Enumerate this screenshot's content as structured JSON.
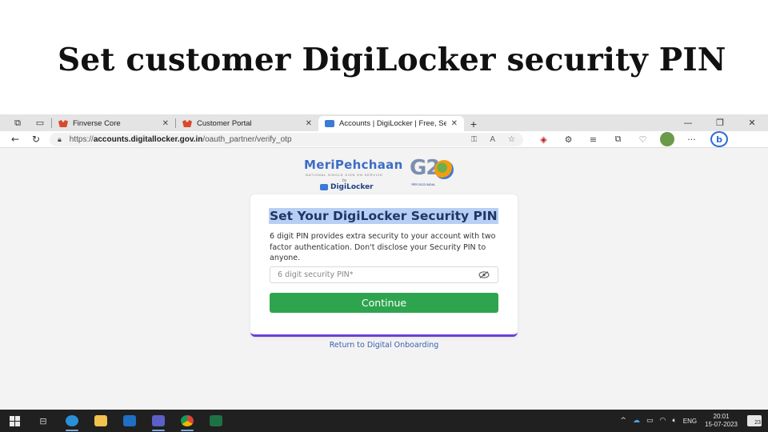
{
  "slide": {
    "title": "Set customer DigiLocker security PIN"
  },
  "browser": {
    "tabs": [
      {
        "label": "Finverse Core",
        "close": "✕"
      },
      {
        "label": "Customer Portal",
        "close": "✕"
      },
      {
        "label": "Accounts | DigiLocker | Free, Sec",
        "close": "✕"
      }
    ],
    "new_tab": "+",
    "window_controls": {
      "minimize": "—",
      "restore": "❐",
      "close": "✕"
    },
    "address": {
      "scheme": "https://",
      "host": "accounts.digitallocker.gov.in",
      "path": "/oauth_partner/verify_otp"
    }
  },
  "page": {
    "logo": {
      "meripehchaan": "MeriPehchaan",
      "tagline": "NATIONAL SINGLE SIGN ON SERVICE",
      "by": "by",
      "digilocker": "DigiLocker",
      "g20": "G2",
      "g20_sub": "भारत 2023 INDIA"
    },
    "card": {
      "title": "Set Your DigiLocker Security PIN",
      "description": "6 digit PIN provides extra security to your account with two factor authentication. Don't disclose your Security PIN to anyone.",
      "pin_placeholder": "6 digit security PIN*",
      "continue_label": "Continue",
      "accent_color": "#6b3fd6",
      "button_color": "#2ea44f"
    },
    "return_link": "Return to Digital Onboarding"
  },
  "taskbar": {
    "language": "ENG",
    "time": "20:01",
    "date": "15-07-2023",
    "notifications": "23"
  }
}
